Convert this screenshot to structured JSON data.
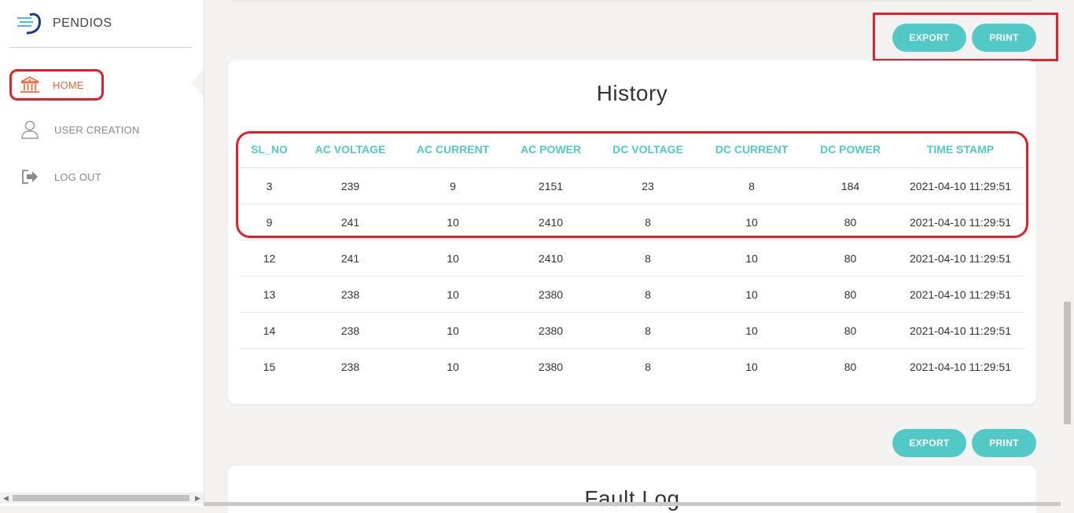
{
  "brand": {
    "name": "PENDIOS",
    "logo_icon": "pendios-logo-icon"
  },
  "sidebar": {
    "items": [
      {
        "label": "HOME",
        "icon": "bank-icon",
        "active": true
      },
      {
        "label": "USER CREATION",
        "icon": "user-icon",
        "active": false
      },
      {
        "label": "LOG OUT",
        "icon": "logout-icon",
        "active": false
      }
    ]
  },
  "toolbar_top": {
    "export_label": "EXPORT",
    "print_label": "PRINT"
  },
  "history": {
    "title": "History",
    "columns": [
      "SL_NO",
      "AC VOLTAGE",
      "AC CURRENT",
      "AC POWER",
      "DC VOLTAGE",
      "DC CURRENT",
      "DC POWER",
      "TIME STAMP"
    ],
    "rows": [
      [
        "3",
        "239",
        "9",
        "2151",
        "23",
        "8",
        "184",
        "2021-04-10 11:29:51"
      ],
      [
        "9",
        "241",
        "10",
        "2410",
        "8",
        "10",
        "80",
        "2021-04-10 11:29:51"
      ],
      [
        "12",
        "241",
        "10",
        "2410",
        "8",
        "10",
        "80",
        "2021-04-10 11:29:51"
      ],
      [
        "13",
        "238",
        "10",
        "2380",
        "8",
        "10",
        "80",
        "2021-04-10 11:29:51"
      ],
      [
        "14",
        "238",
        "10",
        "2380",
        "8",
        "10",
        "80",
        "2021-04-10 11:29:51"
      ],
      [
        "15",
        "238",
        "10",
        "2380",
        "8",
        "10",
        "80",
        "2021-04-10 11:29:51"
      ]
    ]
  },
  "toolbar_bottom": {
    "export_label": "EXPORT",
    "print_label": "PRINT"
  },
  "fault_log": {
    "title": "Fault Log"
  },
  "colors": {
    "accent": "#52c9c7",
    "highlight": "#e0202a",
    "active_nav": "#ef6a3b"
  }
}
